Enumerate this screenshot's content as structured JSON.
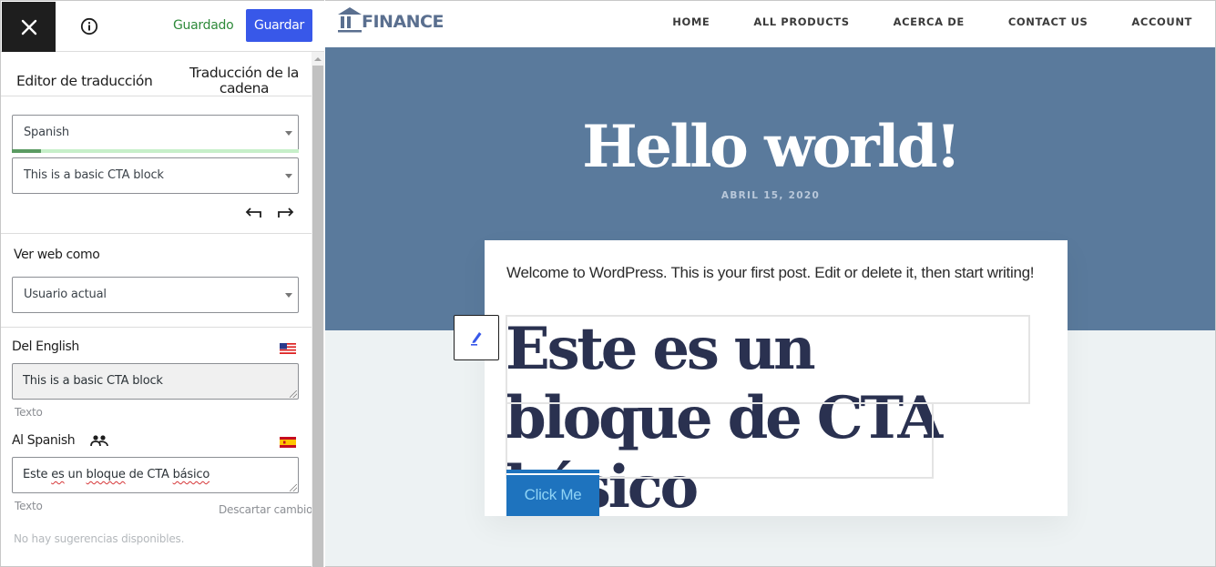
{
  "panel": {
    "saved_status": "Guardado",
    "save_button": "Guardar",
    "tabs": [
      {
        "label": "Editor de traducción"
      },
      {
        "label": "Traducción de la cadena"
      }
    ],
    "language_select": {
      "value": "Spanish",
      "progress_fraction": 0.1
    },
    "string_select": {
      "value": "This is a basic CTA block"
    },
    "view_as": {
      "label": "Ver web como",
      "value": "Usuario actual"
    },
    "source": {
      "label": "Del English",
      "flag": "us-flag-icon",
      "text": "This is a basic CTA block",
      "type_label": "Texto"
    },
    "target": {
      "label": "Al Spanish",
      "flag": "es-flag-icon",
      "text_parts": [
        "Este ",
        "es",
        " un ",
        "bloque",
        " de CTA ",
        "básico"
      ],
      "type_label": "Texto",
      "discard_label": "Descartar cambios"
    },
    "suggestions": "No hay sugerencias disponibles."
  },
  "site": {
    "logo_text": "FINANCE",
    "nav": [
      "HOME",
      "ALL PRODUCTS",
      "ACERCA DE",
      "CONTACT US",
      "ACCOUNT"
    ],
    "hero_title": "Hello world!",
    "hero_date": "ABRIL 15, 2020",
    "intro": "Welcome to WordPress. This is your first post. Edit or delete it, then start writing!",
    "cta_heading": "Este es un bloque de CTA básico",
    "cta_button": "Click Me"
  },
  "colors": {
    "save_button": "#3858e9",
    "saved_text": "#2e8a3a",
    "hero_bg": "#5a7a9c",
    "cta_button": "#1e73be",
    "heading_text": "#2a3150"
  }
}
